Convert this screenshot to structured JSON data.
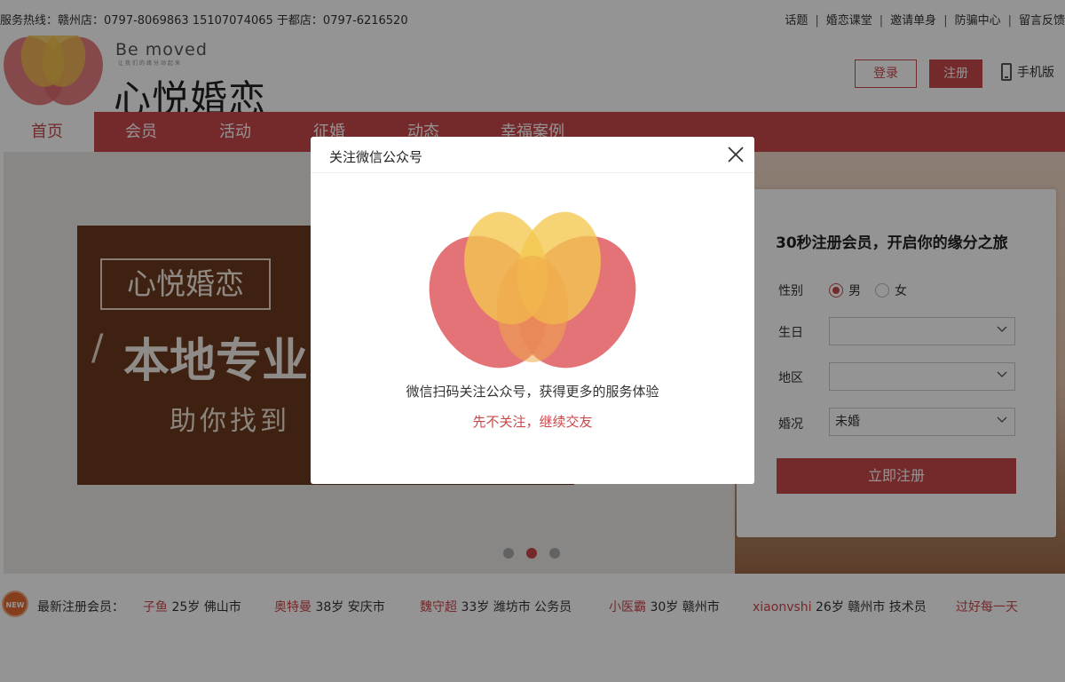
{
  "topbar": {
    "hotline": "服务热线：赣州店：0797-8069863 15107074065 于都店：0797-6216520",
    "links": [
      "话题",
      "婚恋课堂",
      "邀请单身",
      "防骗中心",
      "留言反馈"
    ]
  },
  "header": {
    "logo_en": "Be moved",
    "logo_en_sub": "让我们的缘分动起来",
    "logo_cn": "心悦婚恋",
    "login_label": "登录",
    "register_label": "注册",
    "mobile_label": "手机版"
  },
  "nav": {
    "items": [
      "首页",
      "会员",
      "活动",
      "征婚",
      "动态",
      "幸福案例"
    ]
  },
  "banner": {
    "brand": "心悦婚恋",
    "headline": "本地专业",
    "subline": "助你找到"
  },
  "register_form": {
    "title": "30秒注册会员，开启你的缘分之旅",
    "gender_label": "性别",
    "gender_options": [
      "男",
      "女"
    ],
    "gender_selected": "男",
    "birthday_label": "生日",
    "birthday_value": "",
    "region_label": "地区",
    "region_value": "",
    "marital_label": "婚况",
    "marital_value": "未婚",
    "submit_label": "立即注册"
  },
  "new_members": {
    "badge": "NEW",
    "label": "最新注册会员：",
    "members": [
      {
        "name": "子鱼",
        "info": "25岁 佛山市"
      },
      {
        "name": "奥特曼",
        "info": "38岁 安庆市"
      },
      {
        "name": "魏守超",
        "info": "33岁 潍坊市 公务员"
      },
      {
        "name": "小医霸",
        "info": "30岁 赣州市"
      },
      {
        "name": "xiaonvshi",
        "info": "26岁 赣州市 技术员"
      },
      {
        "name": "过好每一天",
        "info": ""
      }
    ]
  },
  "modal": {
    "title": "关注微信公众号",
    "text": "微信扫码关注公众号，获得更多的服务体验",
    "skip": "先不关注，继续交友"
  },
  "colors": {
    "brand_red": "#c9484b",
    "overlay": "rgba(0,0,0,0.42)"
  }
}
